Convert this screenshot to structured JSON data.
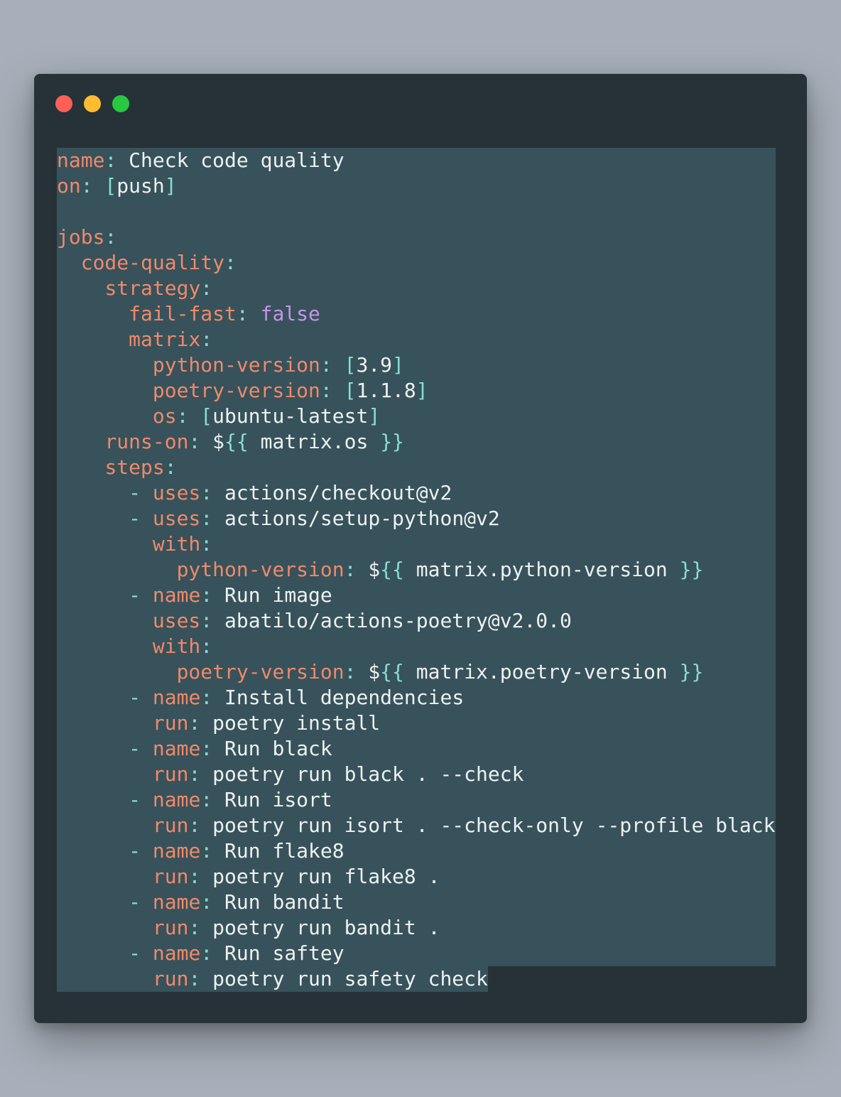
{
  "window": {
    "traffic_lights": [
      {
        "name": "close-dot",
        "color": "#ff5f57"
      },
      {
        "name": "minimize-dot",
        "color": "#febc2e"
      },
      {
        "name": "zoom-dot",
        "color": "#28c840"
      }
    ]
  },
  "colors": {
    "key": "#f0896b",
    "punctuation": "#89ddd2",
    "value": "#eef1f3",
    "boolean": "#c792ea",
    "selection": "#37525a",
    "editor_bg": "#263238",
    "page_bg": "#a7b0ba"
  },
  "code": {
    "lines": [
      [
        {
          "t": "k",
          "s": "name"
        },
        {
          "t": "p",
          "s": ": "
        },
        {
          "t": "v",
          "s": "Check code quality"
        }
      ],
      [
        {
          "t": "k",
          "s": "on"
        },
        {
          "t": "p",
          "s": ": ["
        },
        {
          "t": "v",
          "s": "push"
        },
        {
          "t": "p",
          "s": "]"
        }
      ],
      [],
      [
        {
          "t": "k",
          "s": "jobs"
        },
        {
          "t": "p",
          "s": ":"
        }
      ],
      [
        {
          "t": "v",
          "s": "  "
        },
        {
          "t": "k",
          "s": "code-quality"
        },
        {
          "t": "p",
          "s": ":"
        }
      ],
      [
        {
          "t": "v",
          "s": "    "
        },
        {
          "t": "k",
          "s": "strategy"
        },
        {
          "t": "p",
          "s": ":"
        }
      ],
      [
        {
          "t": "v",
          "s": "      "
        },
        {
          "t": "k",
          "s": "fail-fast"
        },
        {
          "t": "p",
          "s": ": "
        },
        {
          "t": "b",
          "s": "false"
        }
      ],
      [
        {
          "t": "v",
          "s": "      "
        },
        {
          "t": "k",
          "s": "matrix"
        },
        {
          "t": "p",
          "s": ":"
        }
      ],
      [
        {
          "t": "v",
          "s": "        "
        },
        {
          "t": "k",
          "s": "python-version"
        },
        {
          "t": "p",
          "s": ": ["
        },
        {
          "t": "v",
          "s": "3.9"
        },
        {
          "t": "p",
          "s": "]"
        }
      ],
      [
        {
          "t": "v",
          "s": "        "
        },
        {
          "t": "k",
          "s": "poetry-version"
        },
        {
          "t": "p",
          "s": ": ["
        },
        {
          "t": "v",
          "s": "1.1.8"
        },
        {
          "t": "p",
          "s": "]"
        }
      ],
      [
        {
          "t": "v",
          "s": "        "
        },
        {
          "t": "k",
          "s": "os"
        },
        {
          "t": "p",
          "s": ": ["
        },
        {
          "t": "v",
          "s": "ubuntu-latest"
        },
        {
          "t": "p",
          "s": "]"
        }
      ],
      [
        {
          "t": "v",
          "s": "    "
        },
        {
          "t": "k",
          "s": "runs-on"
        },
        {
          "t": "p",
          "s": ": "
        },
        {
          "t": "v",
          "s": "$"
        },
        {
          "t": "p",
          "s": "{{"
        },
        {
          "t": "v",
          "s": " matrix.os "
        },
        {
          "t": "p",
          "s": "}}"
        }
      ],
      [
        {
          "t": "v",
          "s": "    "
        },
        {
          "t": "k",
          "s": "steps"
        },
        {
          "t": "p",
          "s": ":"
        }
      ],
      [
        {
          "t": "v",
          "s": "      "
        },
        {
          "t": "p",
          "s": "- "
        },
        {
          "t": "k",
          "s": "uses"
        },
        {
          "t": "p",
          "s": ": "
        },
        {
          "t": "v",
          "s": "actions/checkout@v2"
        }
      ],
      [
        {
          "t": "v",
          "s": "      "
        },
        {
          "t": "p",
          "s": "- "
        },
        {
          "t": "k",
          "s": "uses"
        },
        {
          "t": "p",
          "s": ": "
        },
        {
          "t": "v",
          "s": "actions/setup-python@v2"
        }
      ],
      [
        {
          "t": "v",
          "s": "        "
        },
        {
          "t": "k",
          "s": "with"
        },
        {
          "t": "p",
          "s": ":"
        }
      ],
      [
        {
          "t": "v",
          "s": "          "
        },
        {
          "t": "k",
          "s": "python-version"
        },
        {
          "t": "p",
          "s": ": "
        },
        {
          "t": "v",
          "s": "$"
        },
        {
          "t": "p",
          "s": "{{"
        },
        {
          "t": "v",
          "s": " matrix.python-version "
        },
        {
          "t": "p",
          "s": "}}"
        }
      ],
      [
        {
          "t": "v",
          "s": "      "
        },
        {
          "t": "p",
          "s": "- "
        },
        {
          "t": "k",
          "s": "name"
        },
        {
          "t": "p",
          "s": ": "
        },
        {
          "t": "v",
          "s": "Run image"
        }
      ],
      [
        {
          "t": "v",
          "s": "        "
        },
        {
          "t": "k",
          "s": "uses"
        },
        {
          "t": "p",
          "s": ": "
        },
        {
          "t": "v",
          "s": "abatilo/actions-poetry@v2.0.0"
        }
      ],
      [
        {
          "t": "v",
          "s": "        "
        },
        {
          "t": "k",
          "s": "with"
        },
        {
          "t": "p",
          "s": ":"
        }
      ],
      [
        {
          "t": "v",
          "s": "          "
        },
        {
          "t": "k",
          "s": "poetry-version"
        },
        {
          "t": "p",
          "s": ": "
        },
        {
          "t": "v",
          "s": "$"
        },
        {
          "t": "p",
          "s": "{{"
        },
        {
          "t": "v",
          "s": " matrix.poetry-version "
        },
        {
          "t": "p",
          "s": "}}"
        }
      ],
      [
        {
          "t": "v",
          "s": "      "
        },
        {
          "t": "p",
          "s": "- "
        },
        {
          "t": "k",
          "s": "name"
        },
        {
          "t": "p",
          "s": ": "
        },
        {
          "t": "v",
          "s": "Install dependencies"
        }
      ],
      [
        {
          "t": "v",
          "s": "        "
        },
        {
          "t": "k",
          "s": "run"
        },
        {
          "t": "p",
          "s": ": "
        },
        {
          "t": "v",
          "s": "poetry install"
        }
      ],
      [
        {
          "t": "v",
          "s": "      "
        },
        {
          "t": "p",
          "s": "- "
        },
        {
          "t": "k",
          "s": "name"
        },
        {
          "t": "p",
          "s": ": "
        },
        {
          "t": "v",
          "s": "Run black"
        }
      ],
      [
        {
          "t": "v",
          "s": "        "
        },
        {
          "t": "k",
          "s": "run"
        },
        {
          "t": "p",
          "s": ": "
        },
        {
          "t": "v",
          "s": "poetry run black . --check"
        }
      ],
      [
        {
          "t": "v",
          "s": "      "
        },
        {
          "t": "p",
          "s": "- "
        },
        {
          "t": "k",
          "s": "name"
        },
        {
          "t": "p",
          "s": ": "
        },
        {
          "t": "v",
          "s": "Run isort"
        }
      ],
      [
        {
          "t": "v",
          "s": "        "
        },
        {
          "t": "k",
          "s": "run"
        },
        {
          "t": "p",
          "s": ": "
        },
        {
          "t": "v",
          "s": "poetry run isort . --check-only --profile black"
        }
      ],
      [
        {
          "t": "v",
          "s": "      "
        },
        {
          "t": "p",
          "s": "- "
        },
        {
          "t": "k",
          "s": "name"
        },
        {
          "t": "p",
          "s": ": "
        },
        {
          "t": "v",
          "s": "Run flake8"
        }
      ],
      [
        {
          "t": "v",
          "s": "        "
        },
        {
          "t": "k",
          "s": "run"
        },
        {
          "t": "p",
          "s": ": "
        },
        {
          "t": "v",
          "s": "poetry run flake8 ."
        }
      ],
      [
        {
          "t": "v",
          "s": "      "
        },
        {
          "t": "p",
          "s": "- "
        },
        {
          "t": "k",
          "s": "name"
        },
        {
          "t": "p",
          "s": ": "
        },
        {
          "t": "v",
          "s": "Run bandit"
        }
      ],
      [
        {
          "t": "v",
          "s": "        "
        },
        {
          "t": "k",
          "s": "run"
        },
        {
          "t": "p",
          "s": ": "
        },
        {
          "t": "v",
          "s": "poetry run bandit ."
        }
      ],
      [
        {
          "t": "v",
          "s": "      "
        },
        {
          "t": "p",
          "s": "- "
        },
        {
          "t": "k",
          "s": "name"
        },
        {
          "t": "p",
          "s": ": "
        },
        {
          "t": "v",
          "s": "Run saftey"
        }
      ],
      [
        {
          "t": "v",
          "s": "        "
        },
        {
          "t": "k",
          "s": "run"
        },
        {
          "t": "p",
          "s": ": "
        },
        {
          "t": "v",
          "s": "poetry run safety check"
        }
      ]
    ]
  }
}
